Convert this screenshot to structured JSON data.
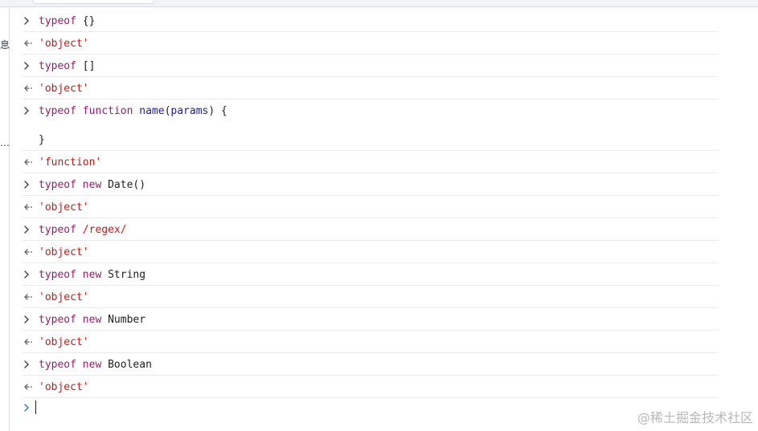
{
  "sidebar_fragments": [
    "息",
    "…"
  ],
  "entries": [
    {
      "kind": "input",
      "tokens": [
        {
          "t": "kw",
          "v": "typeof"
        },
        {
          "t": "plain",
          "v": " {}"
        }
      ]
    },
    {
      "kind": "output",
      "text": "'object'"
    },
    {
      "kind": "input",
      "tokens": [
        {
          "t": "kw",
          "v": "typeof"
        },
        {
          "t": "plain",
          "v": " []"
        }
      ]
    },
    {
      "kind": "output",
      "text": "'object'"
    },
    {
      "kind": "input",
      "line1": [
        {
          "t": "kw",
          "v": "typeof"
        },
        {
          "t": "plain",
          "v": " "
        },
        {
          "t": "kw",
          "v": "function"
        },
        {
          "t": "plain",
          "v": " "
        },
        {
          "t": "fn",
          "v": "name"
        },
        {
          "t": "plain",
          "v": "("
        },
        {
          "t": "fn",
          "v": "params"
        },
        {
          "t": "plain",
          "v": ") {"
        }
      ],
      "line2": "}"
    },
    {
      "kind": "output",
      "text": "'function'"
    },
    {
      "kind": "input",
      "tokens": [
        {
          "t": "kw",
          "v": "typeof"
        },
        {
          "t": "plain",
          "v": " "
        },
        {
          "t": "kw",
          "v": "new"
        },
        {
          "t": "plain",
          "v": " Date()"
        }
      ]
    },
    {
      "kind": "output",
      "text": "'object'"
    },
    {
      "kind": "input",
      "tokens": [
        {
          "t": "kw",
          "v": "typeof"
        },
        {
          "t": "plain",
          "v": " "
        },
        {
          "t": "re",
          "v": "/regex/"
        }
      ]
    },
    {
      "kind": "output",
      "text": "'object'"
    },
    {
      "kind": "input",
      "tokens": [
        {
          "t": "kw",
          "v": "typeof"
        },
        {
          "t": "plain",
          "v": " "
        },
        {
          "t": "kw",
          "v": "new"
        },
        {
          "t": "plain",
          "v": " String"
        }
      ]
    },
    {
      "kind": "output",
      "text": "'object'"
    },
    {
      "kind": "input",
      "tokens": [
        {
          "t": "kw",
          "v": "typeof"
        },
        {
          "t": "plain",
          "v": " "
        },
        {
          "t": "kw",
          "v": "new"
        },
        {
          "t": "plain",
          "v": " Number"
        }
      ]
    },
    {
      "kind": "output",
      "text": "'object'"
    },
    {
      "kind": "input",
      "tokens": [
        {
          "t": "kw",
          "v": "typeof"
        },
        {
          "t": "plain",
          "v": " "
        },
        {
          "t": "kw",
          "v": "new"
        },
        {
          "t": "plain",
          "v": " Boolean"
        }
      ]
    },
    {
      "kind": "output",
      "text": "'object'"
    }
  ],
  "prompt": {
    "value": ""
  },
  "watermark": "@稀土掘金技术社区",
  "icons": {
    "input": "chevron-right-icon",
    "output": "return-arrow-icon",
    "prompt": "prompt-chevron-icon"
  },
  "colors": {
    "keyword": "#9c1a6e",
    "identifier": "#1a1aa6",
    "string": "#c41a16",
    "prompt": "#1a73e8"
  }
}
